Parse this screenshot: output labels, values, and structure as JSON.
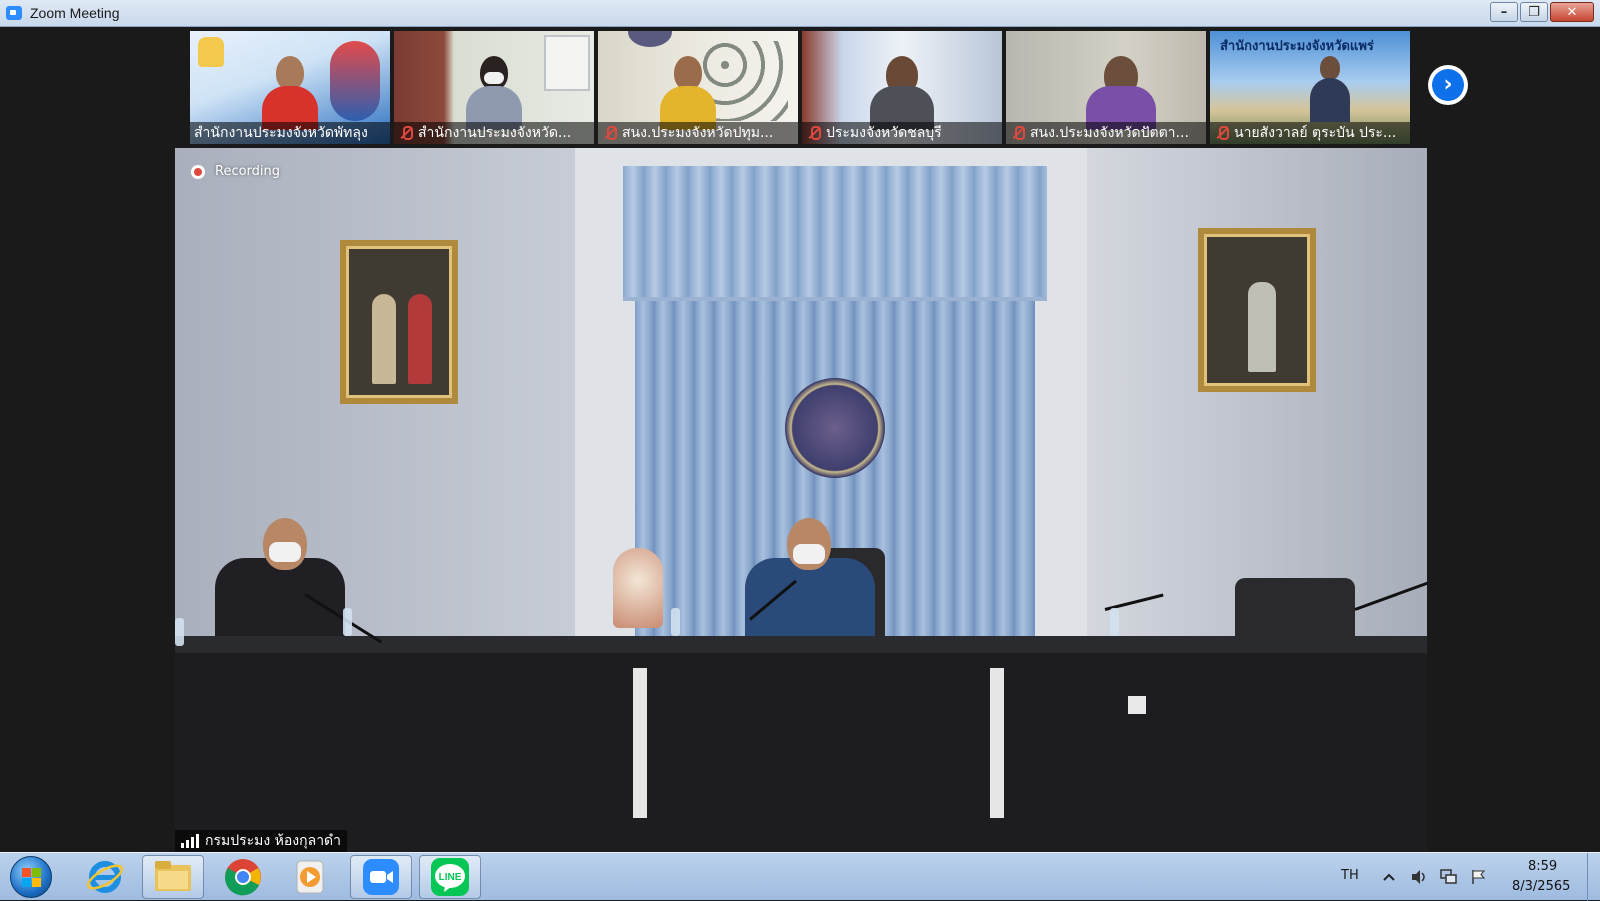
{
  "window": {
    "title": "Zoom Meeting",
    "controls": [
      "minimize-icon",
      "restore-icon",
      "close-icon"
    ]
  },
  "participants": [
    {
      "name": "สำนักงานประมงจังหวัดพัทลุง",
      "muted": false
    },
    {
      "name": "สำนักงานประมงจังหวัด...",
      "muted": true
    },
    {
      "name": "สนง.ประมงจังหวัดปทุม...",
      "muted": true
    },
    {
      "name": "ประมงจังหวัดชลบุรี",
      "muted": true
    },
    {
      "name": "สนง.ประมงจังหวัดปัตตา...",
      "muted": true
    },
    {
      "name": "นายสังวาลย์ ตุระบัน ประ...",
      "muted": true
    }
  ],
  "tile_overlays": {
    "tile6_banner": "สำนักงานประมงจังหวัดแพร่"
  },
  "main": {
    "recording_label": "Recording",
    "speaker_name": "กรมประมง ห้องกุลาดำ"
  },
  "taskbar": {
    "pinned": [
      "windows-start-icon",
      "internet-explorer-icon",
      "file-explorer-icon",
      "chrome-icon",
      "media-player-icon",
      "zoom-icon",
      "line-icon"
    ],
    "line_label": "LINE",
    "language": "TH",
    "time": "8:59",
    "date": "8/3/2565"
  },
  "colors": {
    "zoom_blue": "#2d8cff",
    "muted_red": "#e0483e",
    "line_green": "#06c755"
  }
}
